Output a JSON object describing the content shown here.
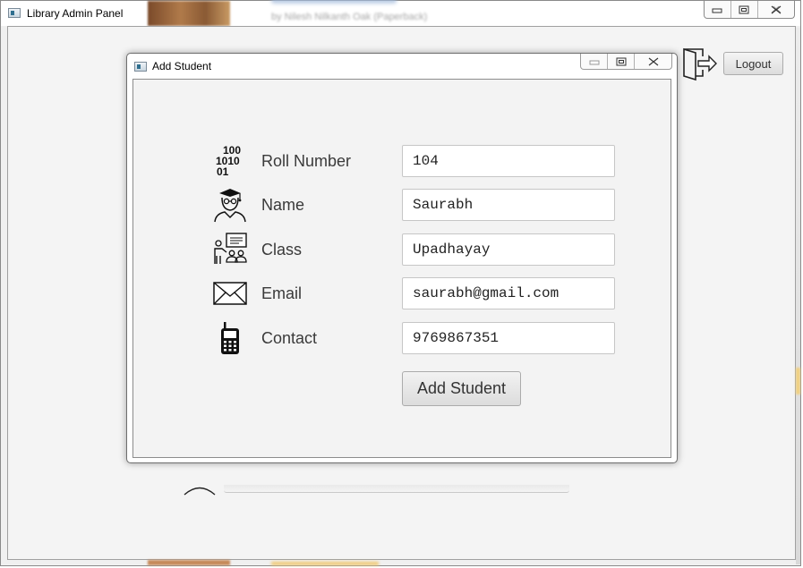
{
  "window": {
    "title": "Library Admin Panel",
    "background_text": "by Nilesh Nilkanth Oak (Paperback)"
  },
  "header": {
    "logout_label": "Logout"
  },
  "dialog": {
    "title": "Add Student",
    "fields": [
      {
        "label": "Roll Number",
        "value": "104",
        "icon": "binary-icon"
      },
      {
        "label": "Name",
        "value": "Saurabh",
        "icon": "graduate-icon"
      },
      {
        "label": "Class",
        "value": "Upadhayay",
        "icon": "classroom-icon"
      },
      {
        "label": "Email",
        "value": "saurabh@gmail.com",
        "icon": "envelope-icon"
      },
      {
        "label": "Contact",
        "value": "9769867351",
        "icon": "phone-icon"
      }
    ],
    "submit_label": "Add Student"
  },
  "icons": {
    "binary_glyph": "100\n1010\n01"
  }
}
